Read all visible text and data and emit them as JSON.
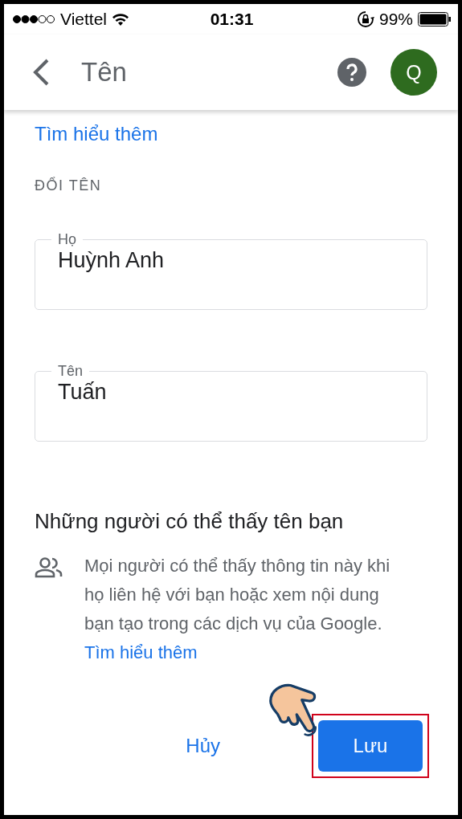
{
  "status_bar": {
    "carrier": "Viettel",
    "time": "01:31",
    "battery": "99%"
  },
  "header": {
    "title": "Tên",
    "avatar": "Q"
  },
  "learn_more": "Tìm hiểu thêm",
  "section_label": "ĐỔI TÊN",
  "fields": [
    {
      "label": "Họ",
      "value": "Huỳnh Anh"
    },
    {
      "label": "Tên",
      "value": "Tuấn"
    }
  ],
  "visibility": {
    "heading": "Những người có thể thấy tên bạn",
    "text": "Mọi người có thể thấy thông tin này khi họ liên hệ với bạn hoặc xem nội dung bạn tạo trong các dịch vụ của Google.",
    "link": "Tìm hiểu thêm"
  },
  "buttons": [
    {
      "label": "Hủy",
      "kind": "text"
    },
    {
      "label": "Lưu",
      "kind": "primary",
      "highlighted": true
    }
  ]
}
